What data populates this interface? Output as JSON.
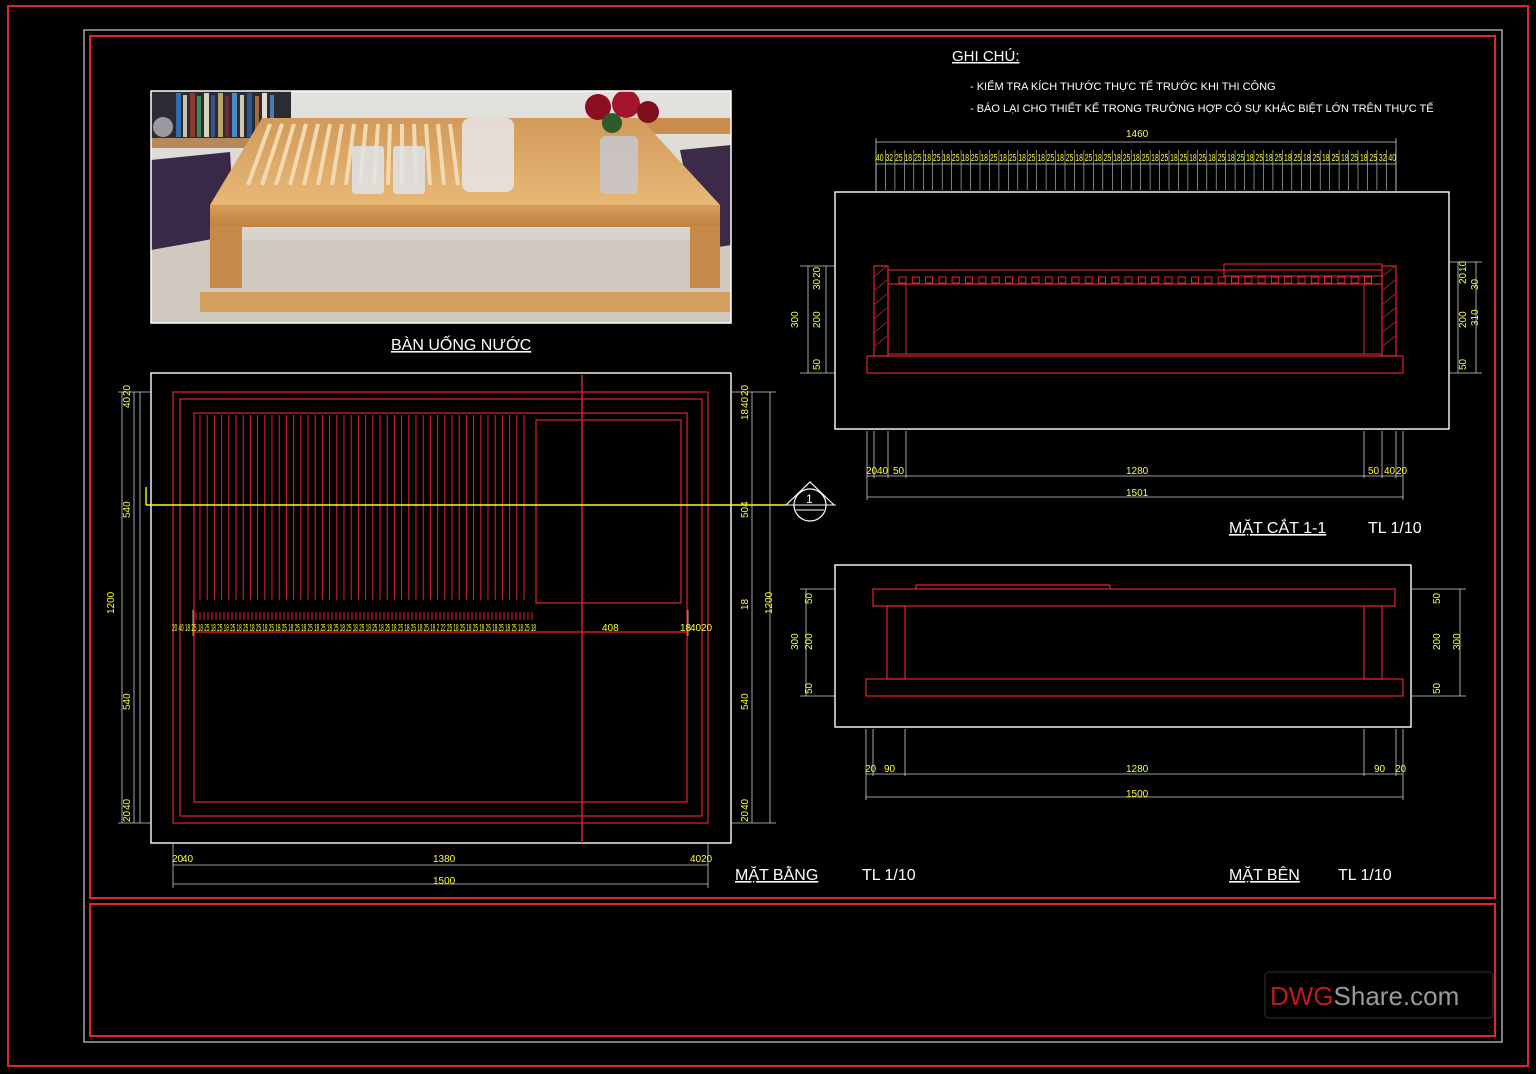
{
  "notes": {
    "title": "GHI CHÚ:",
    "items": [
      "- KIỂM TRA KÍCH THƯỚC THỰC TẾ TRƯỚC KHI THI CÔNG",
      "- BÁO LẠI CHO THIẾT KẾ TRONG TRƯỜNG HỢP CÓ SỰ KHÁC BIỆT LỚN TRÊN THỰC TẾ"
    ]
  },
  "photo": {
    "caption": "BÀN UỐNG NƯỚC"
  },
  "plan": {
    "title": "MẶT BẰNG",
    "scale": "TL 1/10",
    "dims_bottom": [
      "20",
      "40",
      "1380",
      "40",
      "20"
    ],
    "overall_bottom": "1500",
    "dims_left": [
      "40",
      "20",
      "540",
      "1200",
      "540",
      "20",
      "40"
    ],
    "dims_right": [
      "18",
      "40",
      "20",
      "504",
      "18",
      "1200",
      "540",
      "20",
      "40"
    ],
    "slat_row": "20 40 18 25 18 25 18 25 18 25 18 25 18 25 18 25 18 25 18 25 18 25 18 25 18 25 18 25 18 25 18 25 18 25 18 25 18 25 18 25 18 2 22 25 18 25 18 25 18 25 18 25 18 25 18 25 18",
    "slat_right": "408",
    "slat_end": [
      "18",
      "40",
      "20"
    ],
    "section_marker": "1"
  },
  "section": {
    "title": "MẶT CẮT 1-1",
    "scale": "TL 1/10",
    "top_total": "1460",
    "top_row": "40 32 25 18 25 18 25 18 25 18 25 18 25 18 25 18 25 18 25 18 25 18 25 18 25 18 25 18 25 18 25 18 25 18 25 18 25 18 25 18 25 18 25 18 25 18 25 18 25 18 25 18 25 32 40",
    "dims_left": [
      "20",
      "30",
      "300",
      "200",
      "50"
    ],
    "dims_right": [
      "10",
      "20",
      "30",
      "310",
      "200",
      "50"
    ],
    "dims_bottom": [
      "20",
      "40",
      "50",
      "1280",
      "50",
      "40",
      "20"
    ],
    "overall_bottom": "1501"
  },
  "side": {
    "title": "MẶT BÊN",
    "scale": "TL 1/10",
    "dims_left": [
      "50",
      "300",
      "200",
      "50"
    ],
    "dims_right": [
      "50",
      "200",
      "300",
      "50"
    ],
    "dims_bottom": [
      "20",
      "90",
      "1280",
      "90",
      "20"
    ],
    "overall_bottom": "1500"
  },
  "watermark": {
    "part1": "DWG",
    "part2": "Share.com"
  },
  "colors": {
    "frame": "#e0262b",
    "dim": "#ffff33",
    "line": "#ffffff",
    "section": "#ffff00"
  }
}
